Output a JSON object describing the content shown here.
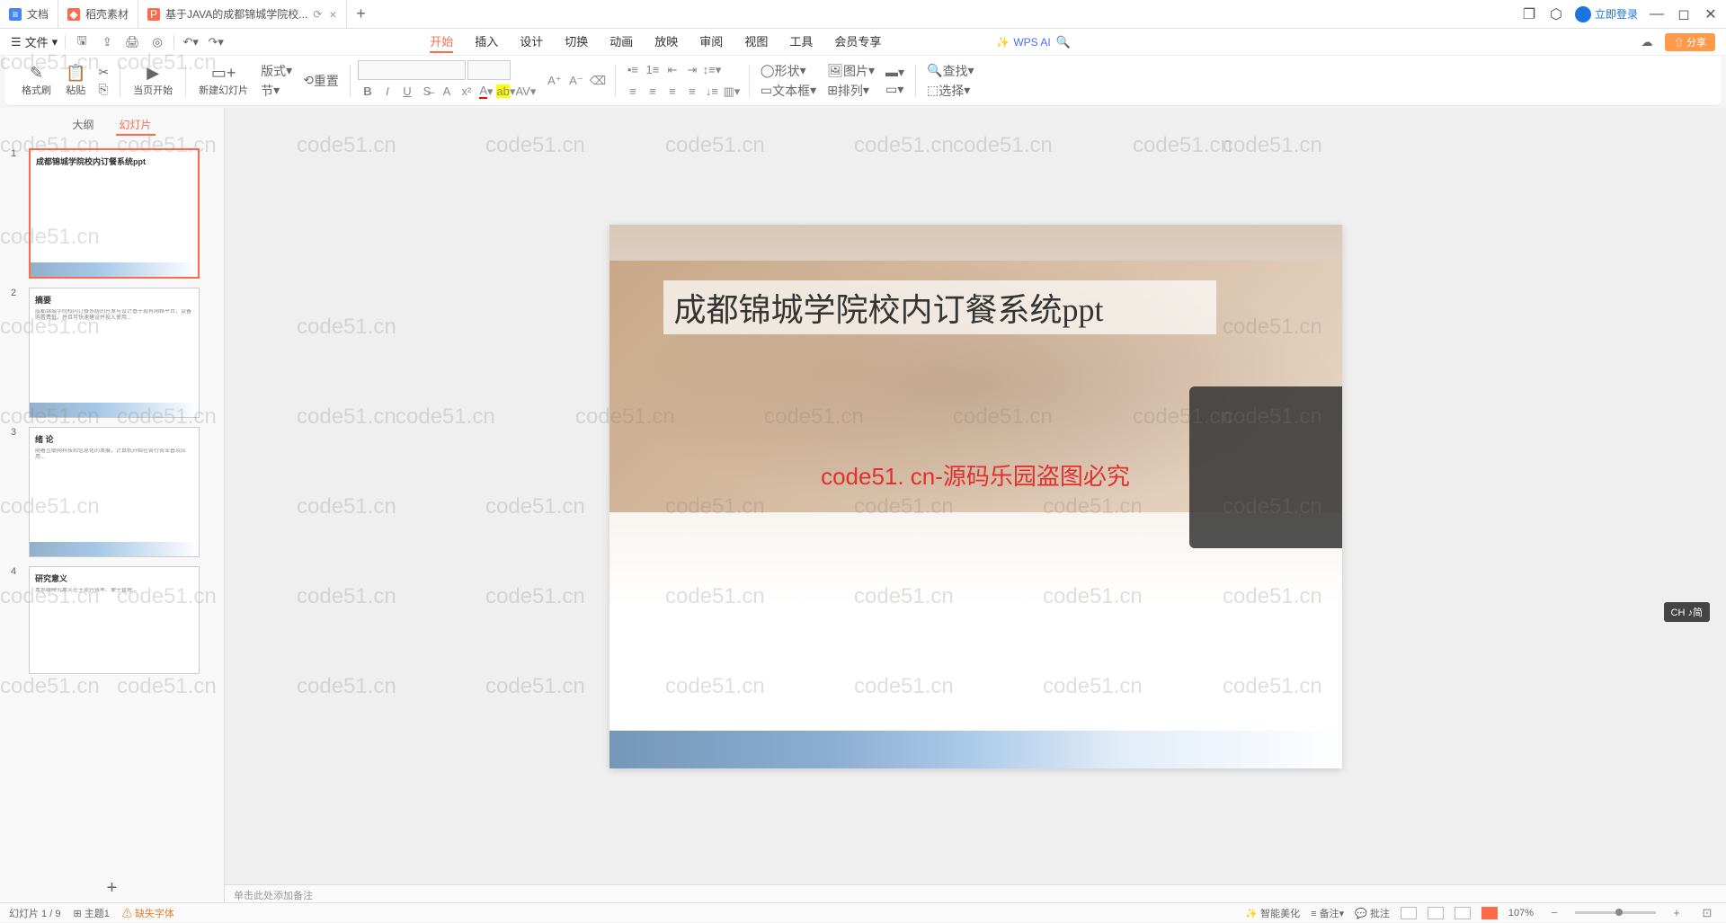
{
  "tabs": {
    "t1": "文档",
    "t2": "稻壳素材",
    "t3": "基于JAVA的成都锦城学院校..."
  },
  "login": "立即登录",
  "file_menu": "文件",
  "menu": {
    "start": "开始",
    "insert": "插入",
    "design": "设计",
    "transition": "切换",
    "animation": "动画",
    "slideshow": "放映",
    "review": "审阅",
    "view": "视图",
    "tools": "工具",
    "member": "会员专享"
  },
  "wpsai": "WPS AI",
  "share": "分享",
  "ribbon": {
    "format_painter": "格式刷",
    "paste": "粘贴",
    "play_current": "当页开始",
    "new_slide": "新建幻灯片",
    "layout": "版式",
    "section": "节",
    "reset": "重置",
    "shape": "形状",
    "picture": "图片",
    "textbox": "文本框",
    "arrange": "排列",
    "find": "查找",
    "select": "选择"
  },
  "panel": {
    "outline": "大纲",
    "slides": "幻灯片"
  },
  "thumb1_title": "成都锦城学院校内订餐系统ppt",
  "thumb2_title": "摘要",
  "thumb3_title": "绪 论",
  "thumb4_title": "研究意义",
  "slide": {
    "title": "成都锦城学院校内订餐系统ppt",
    "watermark_text": "code51. cn-源码乐园盗图必究"
  },
  "notes_placeholder": "单击此处添加备注",
  "status": {
    "slide_count": "幻灯片 1 / 9",
    "theme": "主题1",
    "missing_font": "缺失字体",
    "beautify": "智能美化",
    "notes": "备注",
    "comments": "批注",
    "zoom": "107%"
  },
  "ime": "CH ♪简",
  "wm": "code51.cn"
}
